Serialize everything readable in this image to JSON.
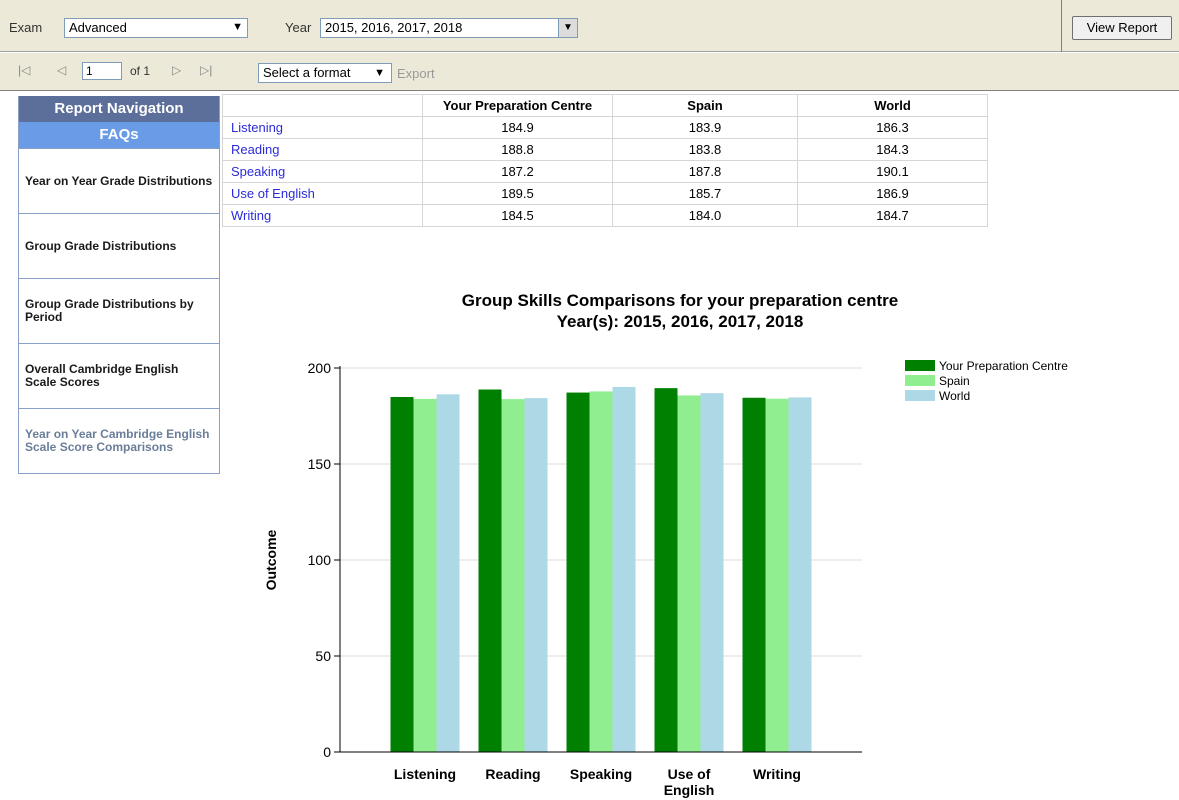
{
  "params": {
    "exam_label": "Exam",
    "exam_value": "Advanced",
    "year_label": "Year",
    "year_value": "2015, 2016, 2017, 2018",
    "view_report": "View Report"
  },
  "toolbar": {
    "page_value": "1",
    "page_of": "of 1",
    "format_select": "Select a format",
    "export": "Export"
  },
  "nav": {
    "header": "Report Navigation",
    "faqs": "FAQs",
    "items": [
      {
        "label": "Year on Year Grade Distributions"
      },
      {
        "label": "Group Grade Distributions"
      },
      {
        "label": "Group Grade Distributions by Period"
      },
      {
        "label": "Overall Cambridge English Scale Scores"
      },
      {
        "label": "Year on Year Cambridge English Scale Score Comparisons"
      }
    ]
  },
  "table": {
    "headers": [
      "",
      "Your Preparation Centre",
      "Spain",
      "World"
    ],
    "rows": [
      {
        "skill": "Listening",
        "centre": "184.9",
        "spain": "183.9",
        "world": "186.3"
      },
      {
        "skill": "Reading",
        "centre": "188.8",
        "spain": "183.8",
        "world": "184.3"
      },
      {
        "skill": "Speaking",
        "centre": "187.2",
        "spain": "187.8",
        "world": "190.1"
      },
      {
        "skill": "Use of English",
        "centre": "189.5",
        "spain": "185.7",
        "world": "186.9"
      },
      {
        "skill": "Writing",
        "centre": "184.5",
        "spain": "184.0",
        "world": "184.7"
      }
    ]
  },
  "chart_data": {
    "type": "bar",
    "title": "Group Skills Comparisons for your preparation centre",
    "subtitle": "Year(s): 2015, 2016, 2017, 2018",
    "xlabel": "",
    "ylabel": "Outcome",
    "categories": [
      "Listening",
      "Reading",
      "Speaking",
      "Use of English",
      "Writing"
    ],
    "series": [
      {
        "name": "Your Preparation Centre",
        "color": "#008000",
        "values": [
          184.9,
          188.8,
          187.2,
          189.5,
          184.5
        ]
      },
      {
        "name": "Spain",
        "color": "#90ee90",
        "values": [
          183.9,
          183.8,
          187.8,
          185.7,
          184.0
        ]
      },
      {
        "name": "World",
        "color": "#add8e6",
        "values": [
          186.3,
          184.3,
          190.1,
          186.9,
          184.7
        ]
      }
    ],
    "ylim": [
      0,
      200
    ],
    "yticks": [
      0,
      50,
      100,
      150,
      200
    ],
    "grid": true,
    "legend": "top-right"
  }
}
